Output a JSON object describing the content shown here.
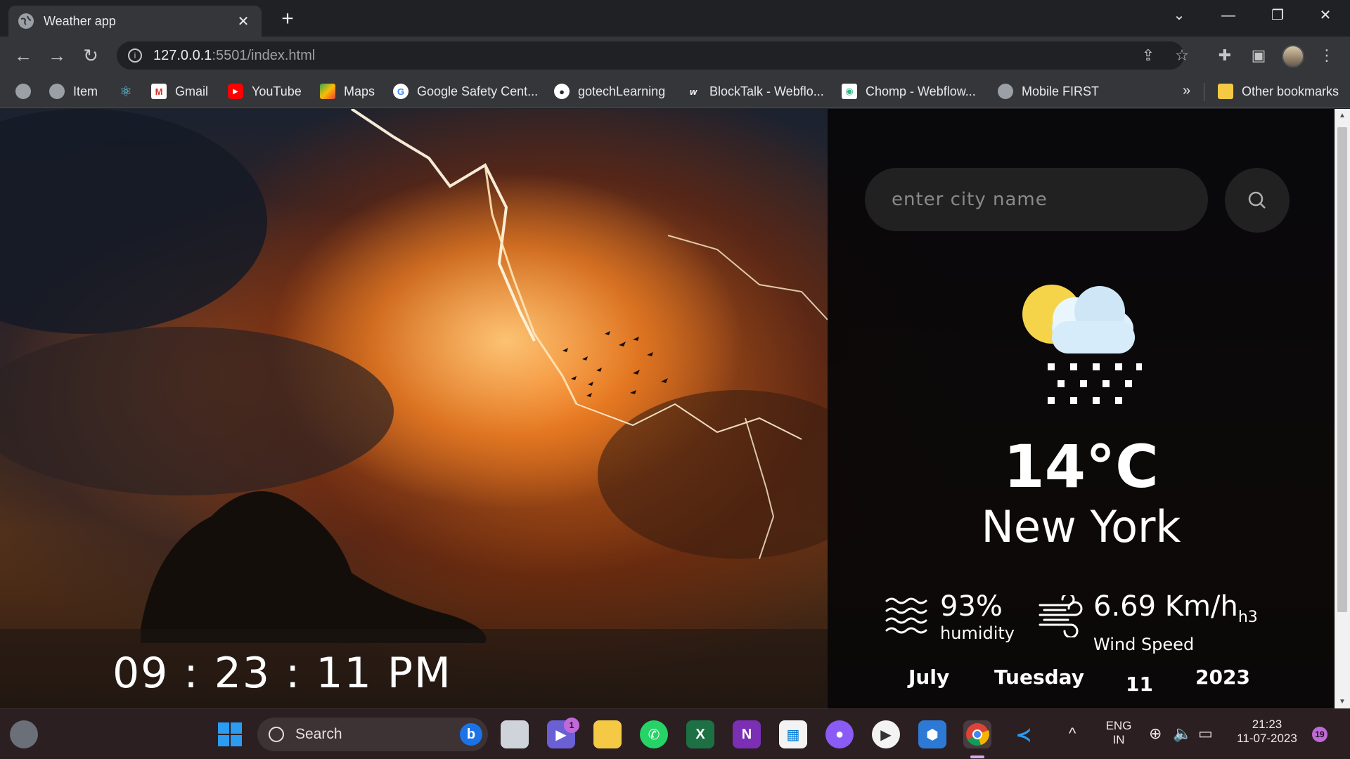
{
  "browser": {
    "tab": {
      "title": "Weather app",
      "close": "✕"
    },
    "new_tab": "+",
    "window_controls": {
      "dropdown": "⌄",
      "minimize": "—",
      "restore": "❐",
      "close": "✕"
    },
    "nav": {
      "back": "←",
      "forward": "→",
      "reload": "↻"
    },
    "address": {
      "host": "127.0.0.1",
      "rest": ":5501/index.html"
    },
    "bookmarks": [
      {
        "label": "",
        "icon": "globe-icon"
      },
      {
        "label": "Item",
        "icon": "globe-icon"
      },
      {
        "label": "",
        "icon": "react-icon"
      },
      {
        "label": "Gmail",
        "icon": "gmail-icon"
      },
      {
        "label": "YouTube",
        "icon": "youtube-icon"
      },
      {
        "label": "Maps",
        "icon": "maps-icon"
      },
      {
        "label": "Google Safety Cent...",
        "icon": "google-icon"
      },
      {
        "label": "gotechLearning",
        "icon": "github-icon"
      },
      {
        "label": "BlockTalk - Webflo...",
        "icon": "webflow-icon"
      },
      {
        "label": "Chomp - Webflow...",
        "icon": "chomp-icon"
      },
      {
        "label": "Mobile FIRST",
        "icon": "globe-icon"
      }
    ],
    "bookmarks_more": "»",
    "other_bookmarks": "Other bookmarks"
  },
  "app": {
    "clock": "09 : 23 : 11 PM",
    "search": {
      "placeholder": "enter city name",
      "value": ""
    },
    "weather_icon": "partly-cloudy-snow-icon",
    "temperature": "14°C",
    "city": "New York",
    "humidity": {
      "value": "93%",
      "label": "humidity"
    },
    "wind": {
      "value": "6.69 Km/h",
      "tag": "h3",
      "label": "Wind Speed"
    },
    "date": {
      "month": "July",
      "weekday": "Tuesday",
      "day": "11",
      "year": "2023"
    }
  },
  "taskbar": {
    "search_label": "Search",
    "teams_badge": "1",
    "language": {
      "line1": "ENG",
      "line2": "IN"
    },
    "time": "21:23",
    "date": "11-07-2023",
    "notification_count": "19"
  },
  "colors": {
    "chrome_dark": "#202124",
    "chrome_toolbar": "#35363a",
    "panel_bg": "#080608",
    "sun": "#f5d44a",
    "cloud": "#cfe6f7",
    "taskbar": "#2b1f21"
  }
}
